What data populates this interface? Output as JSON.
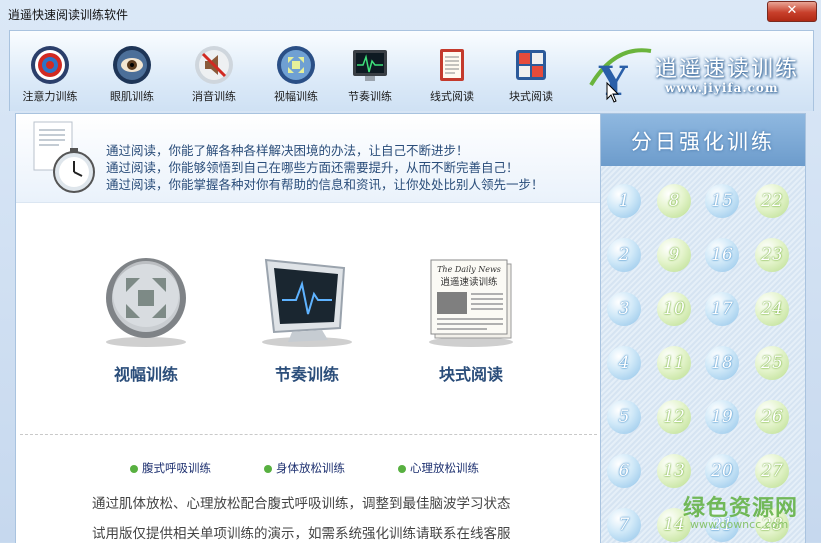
{
  "window": {
    "title": "逍遥快速阅读训练软件",
    "close_label": "✕"
  },
  "toolbar": {
    "items": [
      {
        "label": "注意力训练",
        "icon": "target-icon"
      },
      {
        "label": "眼肌训练",
        "icon": "eye-icon"
      },
      {
        "label": "消音训练",
        "icon": "mute-speaker-icon"
      },
      {
        "label": "视幅训练",
        "icon": "expand-arrows-icon"
      },
      {
        "label": "节奏训练",
        "icon": "monitor-wave-icon"
      },
      {
        "label": "线式阅读",
        "icon": "notepad-icon"
      },
      {
        "label": "块式阅读",
        "icon": "blocks-icon"
      }
    ]
  },
  "logo": {
    "title": "逍遥速读训练",
    "url": "www.jiyifa.com",
    "letter": "Y"
  },
  "banner": {
    "lines": [
      "通过阅读，你能了解各种各样解决困境的办法，让自己不断进步！",
      "通过阅读，你能够领悟到自己在哪些方面还需要提升，从而不断完善自己！",
      "通过阅读，你能掌握各种对你有帮助的信息和资讯，让你处处比别人领先一步！"
    ]
  },
  "features": [
    {
      "label": "视幅训练",
      "icon": "expand-arrows-icon"
    },
    {
      "label": "节奏训练",
      "icon": "monitor-wave-icon"
    },
    {
      "label": "块式阅读",
      "icon": "newspaper-icon",
      "paper_title": "The Daily News",
      "paper_text": "逍遥速读训练"
    }
  ],
  "links": [
    "腹式呼吸训练",
    "身体放松训练",
    "心理放松训练"
  ],
  "description": [
    "通过肌体放松、心理放松配合腹式呼吸训练，调整到最佳脑波学习状态",
    "试用版仅提供相关单项训练的演示，如需系统强化训练请联系在线客服"
  ],
  "sidebar": {
    "title": "分日强化训练",
    "days": [
      "1",
      "2",
      "3",
      "4",
      "5",
      "6",
      "7",
      "8",
      "9",
      "10",
      "11",
      "12",
      "13",
      "14",
      "15",
      "16",
      "17",
      "18",
      "19",
      "20",
      "21",
      "22",
      "23",
      "24",
      "25",
      "26",
      "27",
      "28"
    ]
  },
  "watermark": {
    "main": "绿色资源网",
    "sub": "www.downcc.com"
  },
  "colors": {
    "accent": "#2a4d7a",
    "close": "#c8402b",
    "green": "#58b040"
  }
}
